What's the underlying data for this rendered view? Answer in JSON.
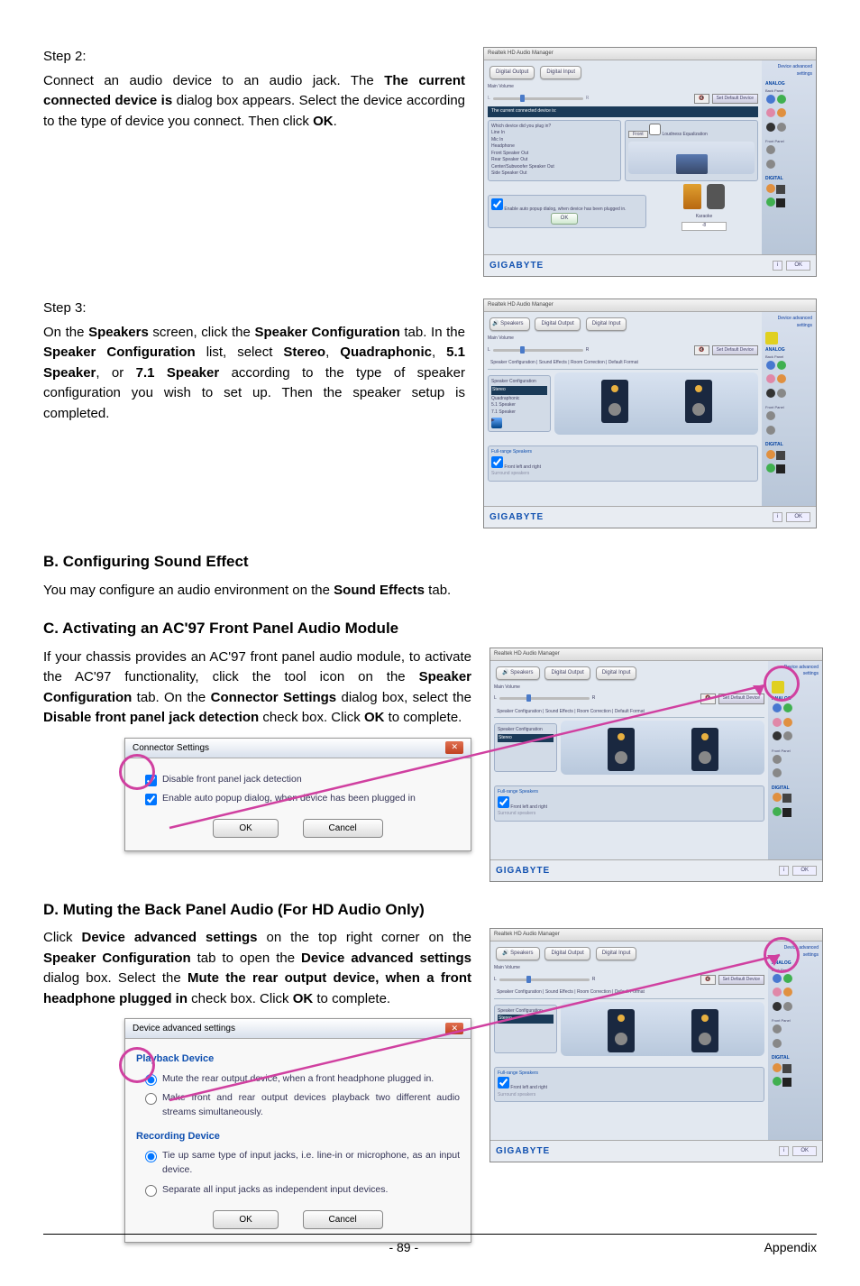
{
  "step2": {
    "label": "Step 2:",
    "para_a": "Connect an audio device to an audio jack. The ",
    "bold_a": "The current connected device is",
    "para_b": " dialog box appears. Select the device according to the type of device you connect. Then click ",
    "bold_b": "OK",
    "para_c": "."
  },
  "step3": {
    "label": "Step 3:",
    "para_a": "On the ",
    "bold_a": "Speakers",
    "para_b": " screen, click the ",
    "bold_b": "Speaker Configuration",
    "para_c": " tab. In the ",
    "bold_c": "Speaker Configuration",
    "para_d": " list, select ",
    "bold_d": "Stereo",
    "para_e": ", ",
    "bold_e": "Quadraphonic",
    "para_f": ", ",
    "bold_f": "5.1 Speaker",
    "para_g": ", or ",
    "bold_g": "7.1 Speaker",
    "para_h": " according to the type of speaker configuration you wish to set up. Then the speaker setup is completed."
  },
  "sectionB": {
    "title": "B. Configuring Sound Effect",
    "para_a": "You may configure an audio environment on the ",
    "bold_a": "Sound Effects",
    "para_b": " tab."
  },
  "sectionC": {
    "title": "C. Activating an AC'97 Front Panel Audio Module",
    "para_a": "If your chassis provides an AC'97 front panel audio module, to activate the AC'97 functionality, click the tool icon on the ",
    "bold_a": "Speaker Configuration",
    "para_b": " tab. On the ",
    "bold_b": "Connector Settings",
    "para_c": " dialog box, select the ",
    "bold_c": "Disable front panel jack detection",
    "para_d": " check box. Click ",
    "bold_d": "OK",
    "para_e": " to complete."
  },
  "sectionD": {
    "title": "D. Muting the Back Panel Audio (For HD Audio Only)",
    "para_a": "Click ",
    "bold_a": "Device advanced settings",
    "para_b": " on the top right corner on the ",
    "bold_b": "Speaker Configuration",
    "para_c": " tab to open the ",
    "bold_c": "Device advanced settings",
    "para_d": " dialog box. Select the ",
    "bold_d": "Mute the rear output device, when a front headphone plugged in",
    "para_e": " check box. Click ",
    "bold_e": "OK",
    "para_f": " to complete."
  },
  "dialog1": {
    "title": "Connector Settings",
    "cb1": "Disable front panel jack detection",
    "cb2": "Enable auto popup dialog, when device has been plugged in",
    "ok": "OK",
    "cancel": "Cancel"
  },
  "dialog2": {
    "title": "Device advanced settings",
    "sec1": "Playback Device",
    "r1": "Mute the rear output device, when a front headphone plugged in.",
    "r2": "Make front and rear output devices playback two different audio streams simultaneously.",
    "sec2": "Recording Device",
    "r3": "Tie up same type of input jacks, i.e. line-in or microphone, as an input device.",
    "r4": "Separate all input jacks as independent input devices.",
    "ok": "OK",
    "cancel": "Cancel"
  },
  "screenshots": {
    "title": "Realtek HD Audio Manager",
    "tab_digital_out": "Digital Output",
    "tab_digital_in": "Digital Input",
    "tab_speakers": "Speakers",
    "main_volume": "Main Volume",
    "set_default": "Set Default Device",
    "connected_label": "The current connected device is:",
    "which_label": "Which device did you plug in?",
    "dev1": "Line In",
    "dev2": "Mic In",
    "dev3": "Headphone",
    "dev4": "Front Speaker Out",
    "dev5": "Rear Speaker Out",
    "dev6": "Center/Subwoofer Speaker Out",
    "dev7": "Side Speaker Out",
    "front": "Front",
    "loudness": "Loudness Equalization",
    "auto_popup": "Enable auto popup dialog, when device has been plugged in.",
    "ok": "OK",
    "karaoke": "Karaoke",
    "brand": "GIGABYTE",
    "analog": "ANALOG",
    "back_panel": "Back Panel",
    "front_panel": "Front Panel",
    "digital": "DIGITAL",
    "dev_adv": "Device advanced settings",
    "tabs_row": "Speaker Configuration | Sound Effects | Room Correction | Default Format",
    "spk_conf": "Speaker Configuration",
    "cfg_stereo": "Stereo",
    "cfg_quad": "Quadraphonic",
    "cfg_51": "5.1 Speaker",
    "cfg_71": "7.1 Speaker",
    "full_range": "Full-range Speakers",
    "front_lr": "Front left and right",
    "surround": "Surround speakers"
  },
  "footer": {
    "page": "- 89 -",
    "label": "Appendix"
  }
}
